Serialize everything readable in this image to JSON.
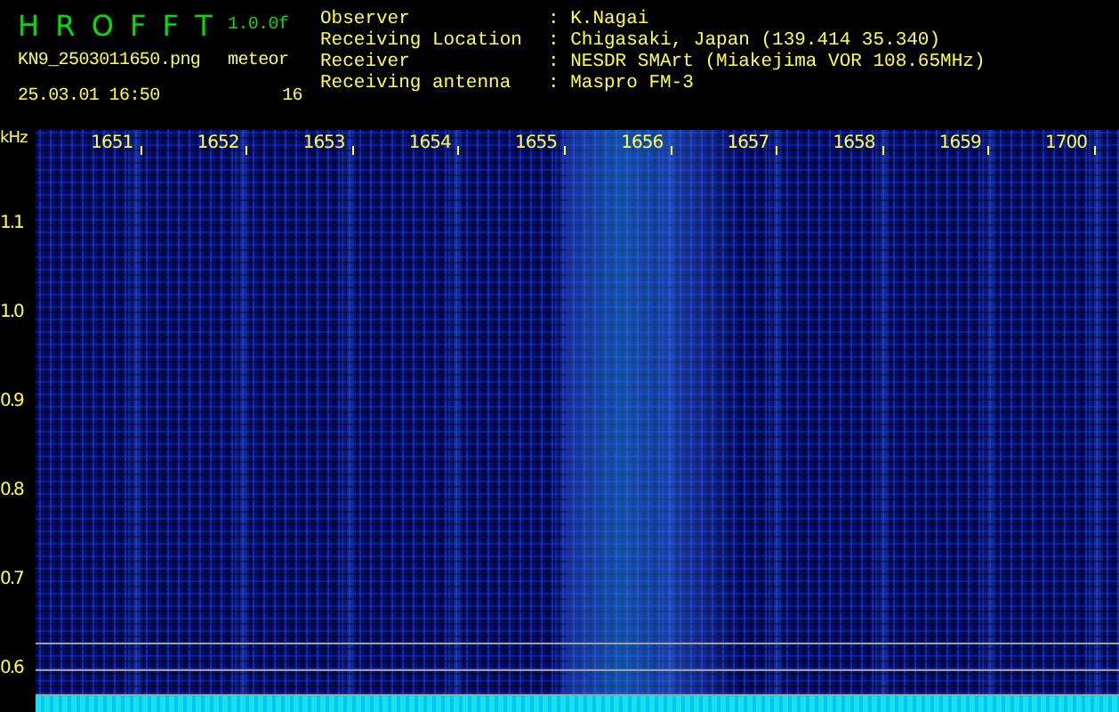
{
  "app": {
    "title": "H R O F F T",
    "version": "1.0.0f",
    "file": "KN9_2503011650.png",
    "mode": "meteor",
    "timestamp": "25.03.01 16:50",
    "count": "16"
  },
  "info": [
    {
      "label": "Observer",
      "value": ": K.Nagai"
    },
    {
      "label": "Receiving Location",
      "value": ": Chigasaki, Japan (139.414 35.340)"
    },
    {
      "label": "Receiver",
      "value": ": NESDR SMArt (Miakejima VOR 108.65MHz)"
    },
    {
      "label": "Receiving antenna",
      "value": ": Maspro FM-3"
    }
  ],
  "plot": {
    "unit": "kHz",
    "x_labels": [
      "1651",
      "1652",
      "1653",
      "1654",
      "1655",
      "1656",
      "1657",
      "1658",
      "1659",
      "1700"
    ],
    "y_labels": [
      "1.1",
      "1.0",
      "0.9",
      "0.8",
      "0.7",
      "0.6"
    ]
  }
}
